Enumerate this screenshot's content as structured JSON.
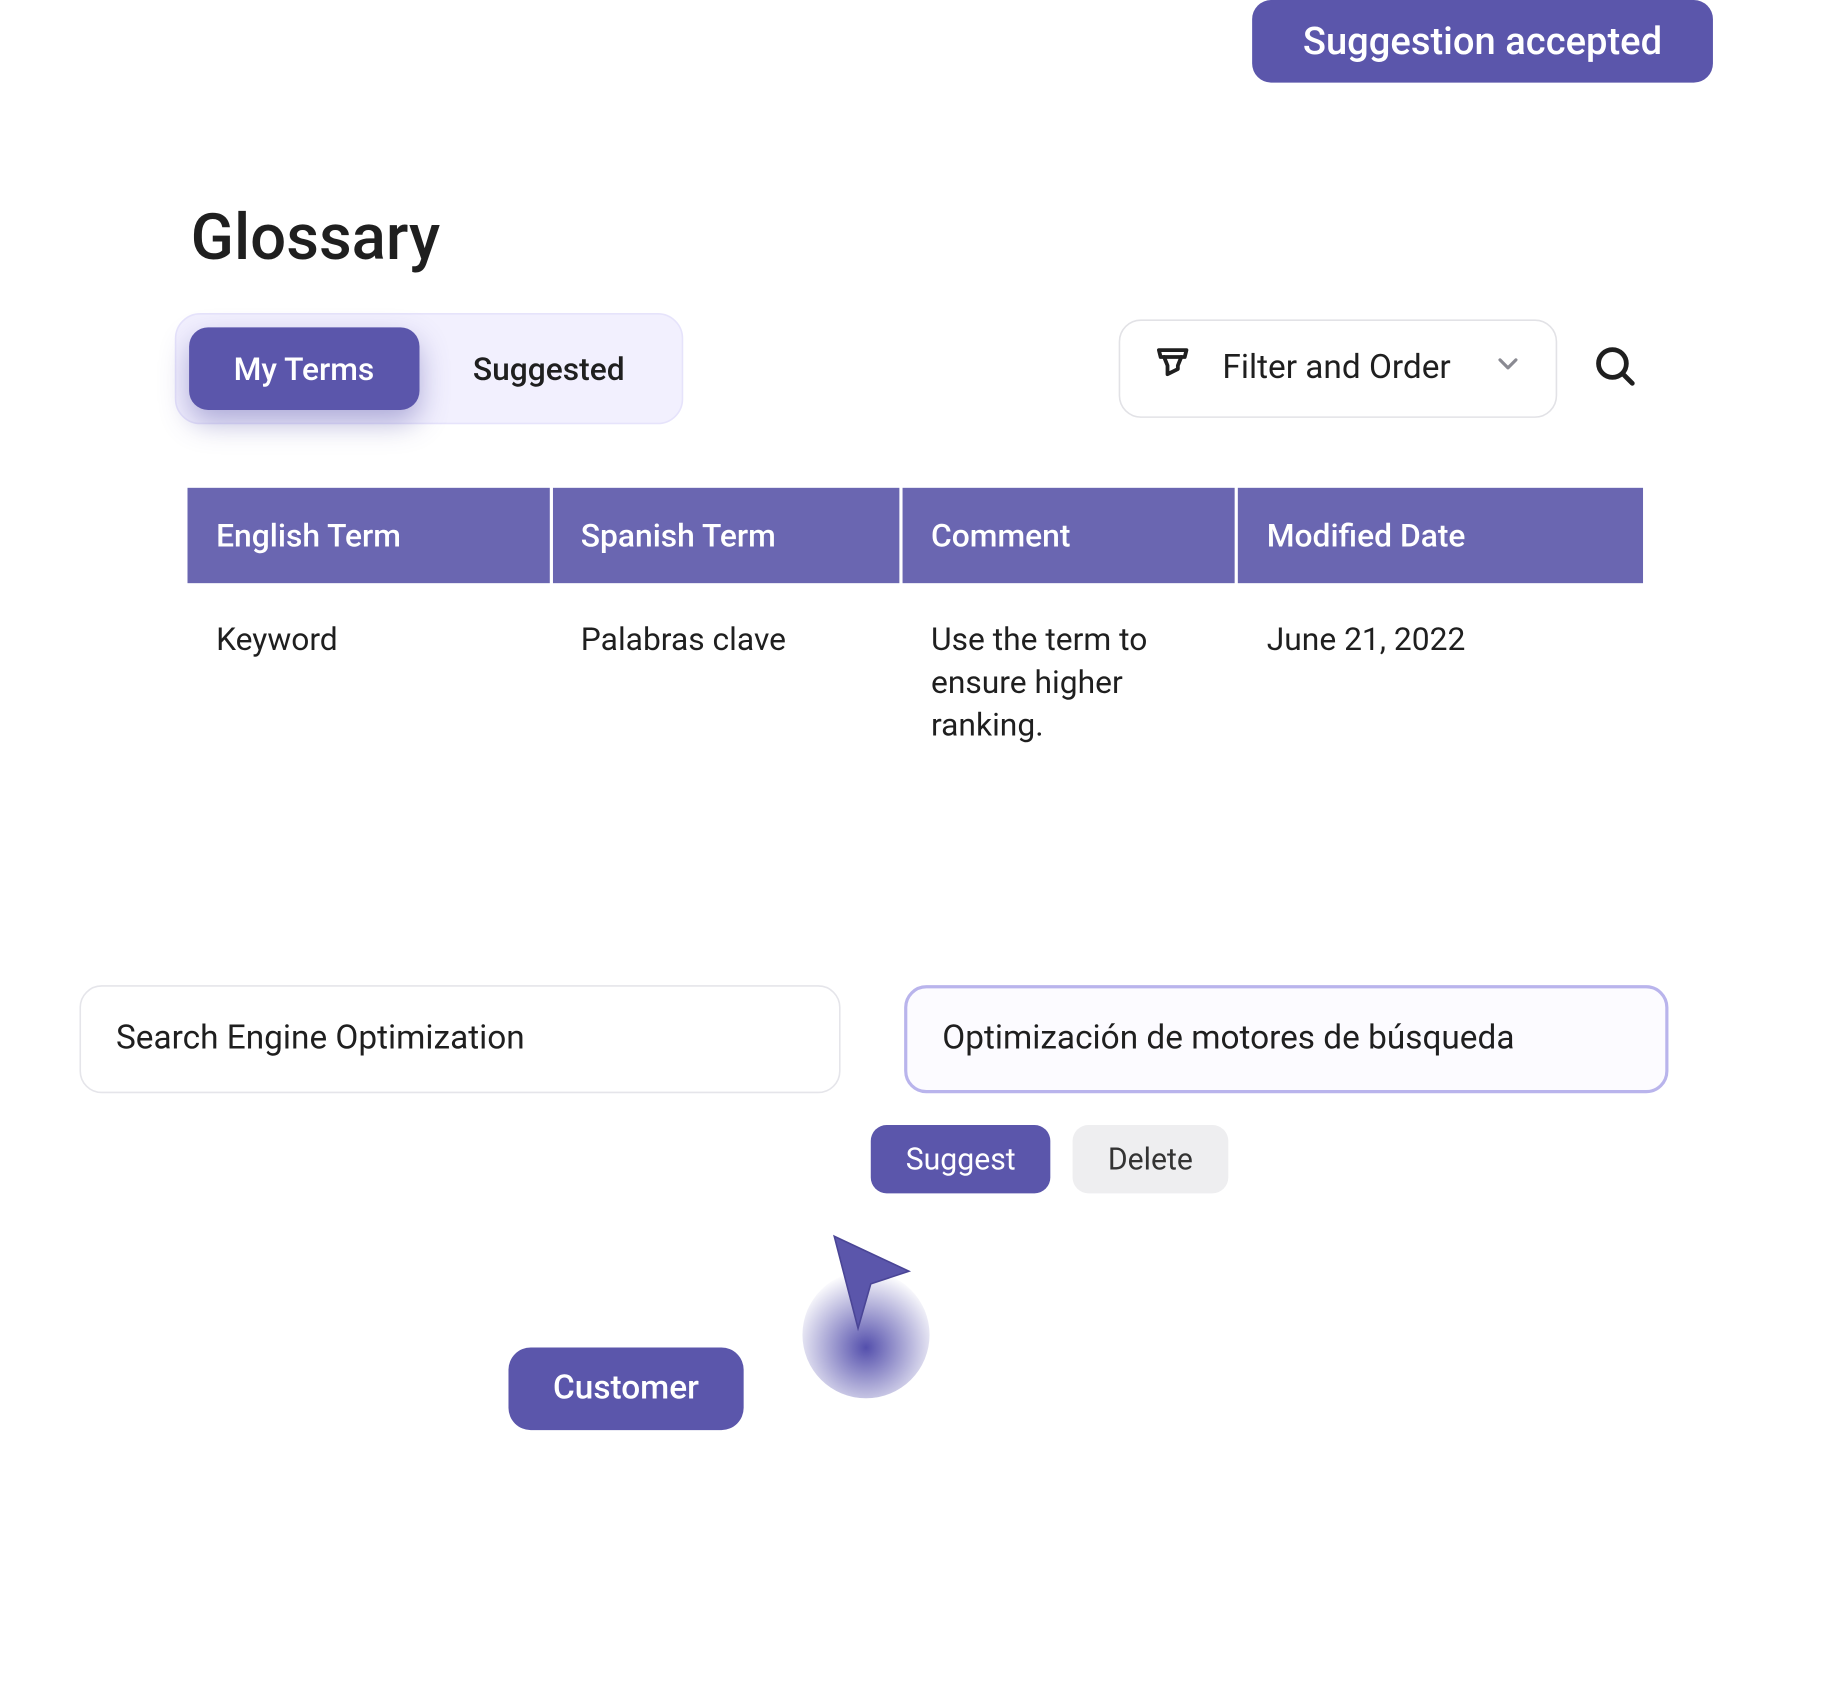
{
  "toast": {
    "message": "Suggestion accepted"
  },
  "page": {
    "title": "Glossary"
  },
  "tabs": {
    "my_terms": "My Terms",
    "suggested": "Suggested"
  },
  "filter": {
    "label": "Filter and Order"
  },
  "table": {
    "headers": {
      "english": "English Term",
      "spanish": "Spanish Term",
      "comment": "Comment",
      "modified": "Modified Date"
    },
    "rows": [
      {
        "english": "Keyword",
        "spanish": "Palabras clave",
        "comment": "Use the term to ensure higher ranking.",
        "modified": "June 21, 2022"
      }
    ]
  },
  "form": {
    "source_value": "Search Engine Optimization",
    "target_value": "Optimización de motores de búsqueda",
    "suggest_label": "Suggest",
    "delete_label": "Delete"
  },
  "presence": {
    "user_label": "Customer"
  }
}
